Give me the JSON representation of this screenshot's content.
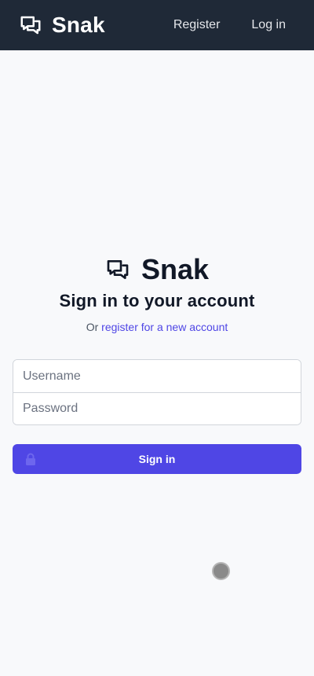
{
  "header": {
    "brand": "Snak",
    "brand_icon": "chat-bubbles-icon",
    "nav": [
      "Register",
      "Log in"
    ],
    "bg_color": "#1f2937"
  },
  "login": {
    "logo_text": "Snak",
    "logo_icon": "chat-bubbles-icon",
    "title": "Sign in to your account",
    "subline_prefix": "Or ",
    "subline_link": "register for a new account",
    "username_placeholder": "Username",
    "password_placeholder": "Password",
    "submit_label": "Sign in",
    "submit_icon": "lock-icon",
    "accent_color": "#4f46e5"
  }
}
